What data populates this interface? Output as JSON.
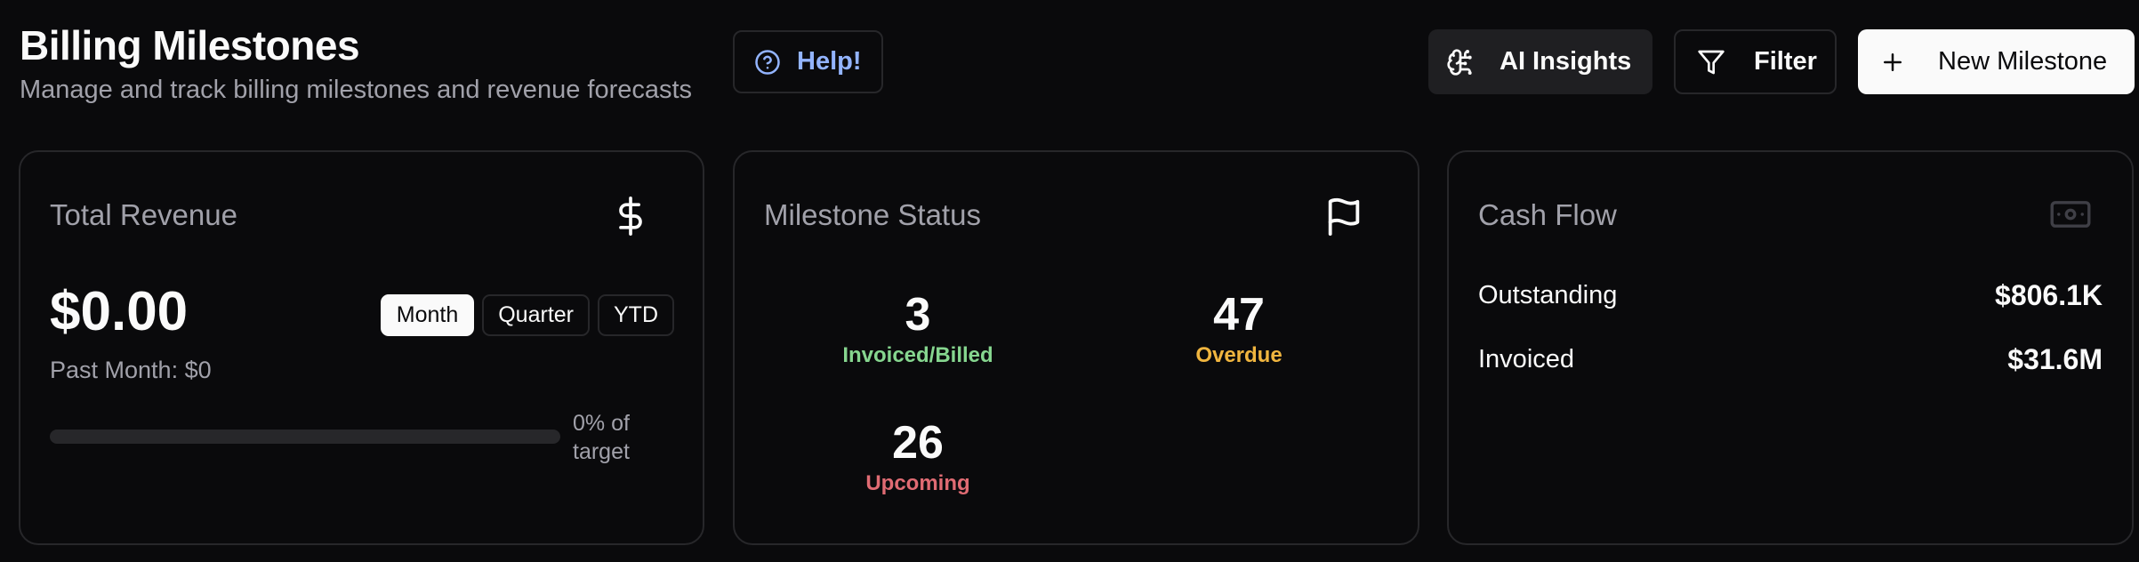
{
  "header": {
    "title": "Billing Milestones",
    "subtitle": "Manage and track billing milestones and revenue forecasts"
  },
  "toolbar": {
    "help_label": "Help!",
    "ai_insights_label": "AI Insights",
    "filter_label": "Filter",
    "new_milestone_label": "New Milestone"
  },
  "revenue_card": {
    "title": "Total Revenue",
    "icon": "dollar-sign-icon",
    "value": "$0.00",
    "tabs": [
      {
        "label": "Month",
        "active": true
      },
      {
        "label": "Quarter",
        "active": false
      },
      {
        "label": "YTD",
        "active": false
      }
    ],
    "past_month": "Past Month: $0",
    "progress_percent": 0,
    "progress_label": "0% of target"
  },
  "status_card": {
    "title": "Milestone Status",
    "icon": "flag-icon",
    "stats": [
      {
        "count": "3",
        "label": "Invoiced/Billed"
      },
      {
        "count": "47",
        "label": "Overdue"
      },
      {
        "count": "26",
        "label": "Upcoming"
      }
    ]
  },
  "cashflow_card": {
    "title": "Cash Flow",
    "icon": "banknote-icon",
    "rows": [
      {
        "label": "Outstanding",
        "value": "$806.1K"
      },
      {
        "label": "Invoiced",
        "value": "$31.6M"
      }
    ]
  },
  "colors": {
    "background": "#0a0a0c",
    "help_text": "#93b4ff",
    "invoiced": "#86d68f",
    "overdue": "#f0b53f",
    "upcoming": "#e06b73"
  }
}
